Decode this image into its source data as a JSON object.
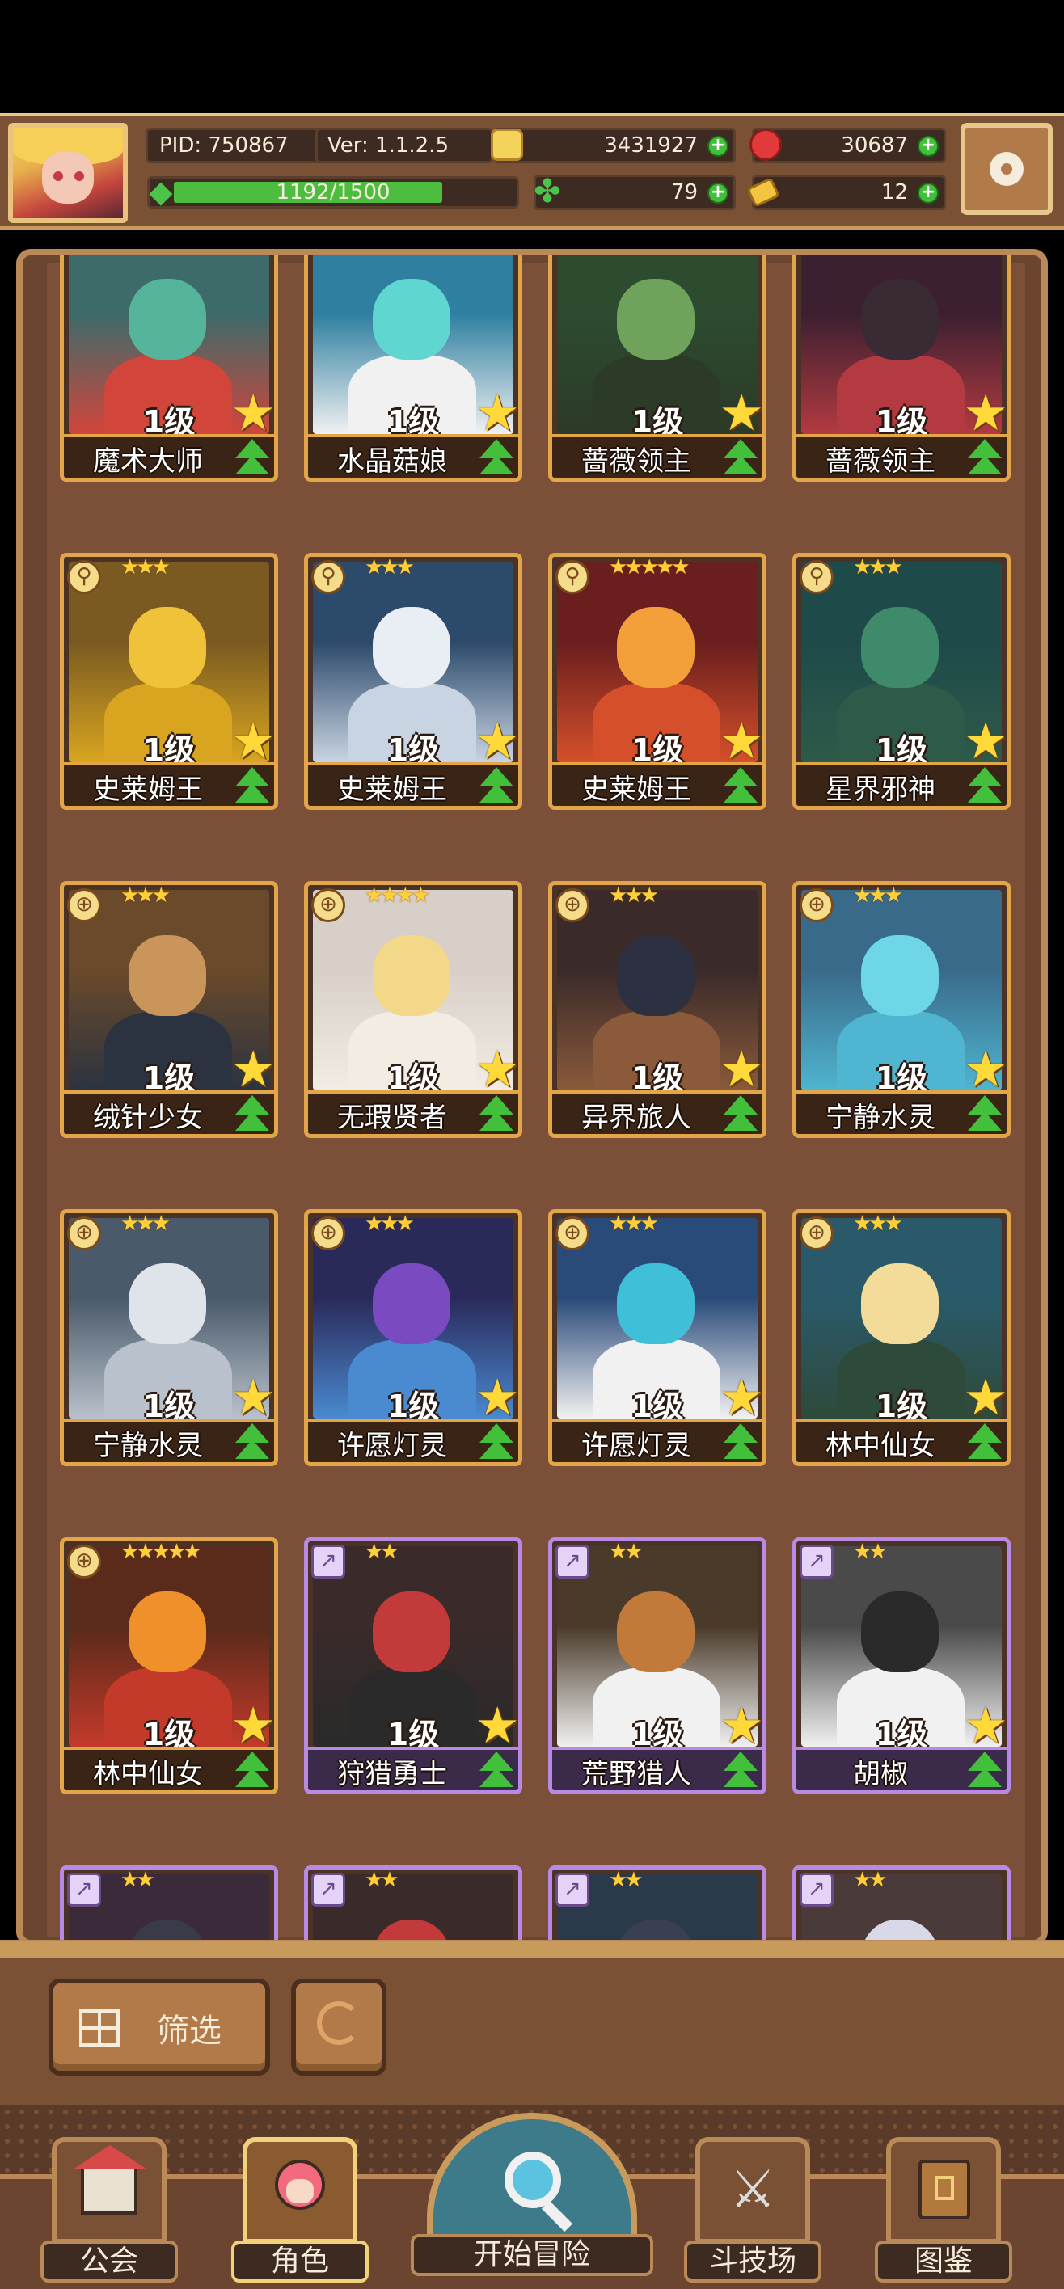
{
  "header": {
    "pid": "PID: 750867",
    "version": "Ver: 1.1.2.5",
    "energy_text": "1192/1500",
    "energy_fraction": 0.795,
    "gold": "3431927",
    "gems": "30687",
    "clovers": "79",
    "tickets": "12",
    "plus": "+"
  },
  "cards": [
    {
      "level": "1级",
      "name": "魔术大师",
      "stars": "",
      "frame": "gold",
      "kind": "",
      "colors": [
        "#3c6b6a",
        "#55b59a",
        "#d1453b"
      ]
    },
    {
      "level": "1级",
      "name": "水晶菇娘",
      "stars": "",
      "frame": "gold",
      "kind": "",
      "colors": [
        "#2e7fa0",
        "#5fd6d0",
        "#f1f1f1"
      ]
    },
    {
      "level": "1级",
      "name": "蔷薇领主",
      "stars": "",
      "frame": "gold",
      "kind": "",
      "colors": [
        "#2c4b2f",
        "#6fa25a",
        "#2c3a28"
      ]
    },
    {
      "level": "1级",
      "name": "蔷薇领主",
      "stars": "",
      "frame": "gold",
      "kind": "",
      "colors": [
        "#3c2030",
        "#3a2a34",
        "#b33a40"
      ]
    },
    {
      "level": "1级",
      "name": "史莱姆王",
      "stars": "★★★",
      "frame": "gold",
      "kind": "⚲",
      "colors": [
        "#7a5a20",
        "#f0c23a",
        "#d9a520"
      ]
    },
    {
      "level": "1级",
      "name": "史莱姆王",
      "stars": "★★★",
      "frame": "gold",
      "kind": "⚲",
      "colors": [
        "#2c4a6a",
        "#e9eef5",
        "#c9d4e3"
      ]
    },
    {
      "level": "1级",
      "name": "史莱姆王",
      "stars": "★★★★★",
      "frame": "gold",
      "kind": "⚲",
      "colors": [
        "#6a1e1e",
        "#f3a03a",
        "#d5502a"
      ]
    },
    {
      "level": "1级",
      "name": "星界邪神",
      "stars": "★★★",
      "frame": "gold",
      "kind": "⚲",
      "colors": [
        "#1e4a4a",
        "#3f8a6a",
        "#2e5a4a"
      ]
    },
    {
      "level": "1级",
      "name": "绒针少女",
      "stars": "★★★",
      "frame": "gold",
      "kind": "⊕",
      "colors": [
        "#6a4a2a",
        "#c9955a",
        "#2c3340"
      ]
    },
    {
      "level": "1级",
      "name": "无瑕贤者",
      "stars": "★★★★",
      "frame": "gold",
      "kind": "⊕",
      "colors": [
        "#d8d0c8",
        "#f3d88a",
        "#f3ece3"
      ]
    },
    {
      "level": "1级",
      "name": "异界旅人",
      "stars": "★★★",
      "frame": "gold",
      "kind": "⊕",
      "colors": [
        "#3a2a2a",
        "#2c3040",
        "#8a5a3a"
      ]
    },
    {
      "level": "1级",
      "name": "宁静水灵",
      "stars": "★★★",
      "frame": "gold",
      "kind": "⊕",
      "colors": [
        "#3a6a8a",
        "#6fd6e8",
        "#4fb5d0"
      ]
    },
    {
      "level": "1级",
      "name": "宁静水灵",
      "stars": "★★★",
      "frame": "gold",
      "kind": "⊕",
      "colors": [
        "#4a5a6a",
        "#dfe4ea",
        "#b9c2cc"
      ]
    },
    {
      "level": "1级",
      "name": "许愿灯灵",
      "stars": "★★★",
      "frame": "gold",
      "kind": "⊕",
      "colors": [
        "#2a2a5a",
        "#7a4ac0",
        "#4a8ad0"
      ]
    },
    {
      "level": "1级",
      "name": "许愿灯灵",
      "stars": "★★★",
      "frame": "gold",
      "kind": "⊕",
      "colors": [
        "#2a4a7a",
        "#3fc0d8",
        "#f1f1f1"
      ]
    },
    {
      "level": "1级",
      "name": "林中仙女",
      "stars": "★★★",
      "frame": "gold",
      "kind": "⊕",
      "colors": [
        "#2a5a6a",
        "#f3dc9a",
        "#2e4a3a"
      ]
    },
    {
      "level": "1级",
      "name": "林中仙女",
      "stars": "★★★★★",
      "frame": "gold",
      "kind": "⊕",
      "colors": [
        "#5a2a1a",
        "#f0902a",
        "#c33a2a"
      ]
    },
    {
      "level": "1级",
      "name": "狩猎勇士",
      "stars": "★★",
      "frame": "purple",
      "kind": "↗",
      "colors": [
        "#3a2a2a",
        "#c33a3a",
        "#2a2a2a"
      ]
    },
    {
      "level": "1级",
      "name": "荒野猎人",
      "stars": "★★",
      "frame": "purple",
      "kind": "↗",
      "colors": [
        "#4a3a2a",
        "#c27a3a",
        "#f1f1f1"
      ]
    },
    {
      "level": "1级",
      "name": "胡椒",
      "stars": "★★",
      "frame": "purple",
      "kind": "↗",
      "colors": [
        "#4a4a4a",
        "#2a2a2a",
        "#f1f1f1"
      ]
    },
    {
      "level": "",
      "name": "",
      "stars": "★★",
      "frame": "purple",
      "kind": "↗",
      "colors": [
        "#3a2a3a",
        "#3a3a4a",
        "#c9b9c9"
      ]
    },
    {
      "level": "",
      "name": "",
      "stars": "★★",
      "frame": "purple",
      "kind": "↗",
      "colors": [
        "#3a2a2a",
        "#c33a3a",
        "#3a2a2a"
      ]
    },
    {
      "level": "",
      "name": "",
      "stars": "★★",
      "frame": "purple",
      "kind": "↗",
      "colors": [
        "#2a3a4a",
        "#3a4050",
        "#3a4050"
      ]
    },
    {
      "level": "",
      "name": "",
      "stars": "★★",
      "frame": "purple",
      "kind": "↗",
      "colors": [
        "#4a3a3a",
        "#d8d8e8",
        "#c9c9d9"
      ]
    }
  ],
  "filter": {
    "label": "筛选"
  },
  "nav": [
    {
      "label": "公会",
      "icon": "guild-house-icon"
    },
    {
      "label": "角色",
      "icon": "character-icon"
    },
    {
      "label": "开始冒险",
      "icon": "adventure-magnifier-icon"
    },
    {
      "label": "斗技场",
      "icon": "crossed-swords-icon"
    },
    {
      "label": "图鉴",
      "icon": "codex-book-icon"
    }
  ],
  "colors": {
    "gold_frame": "#e2a547",
    "purple_frame": "#b989e6",
    "green": "#43c03b",
    "panel": "#7a5134"
  }
}
